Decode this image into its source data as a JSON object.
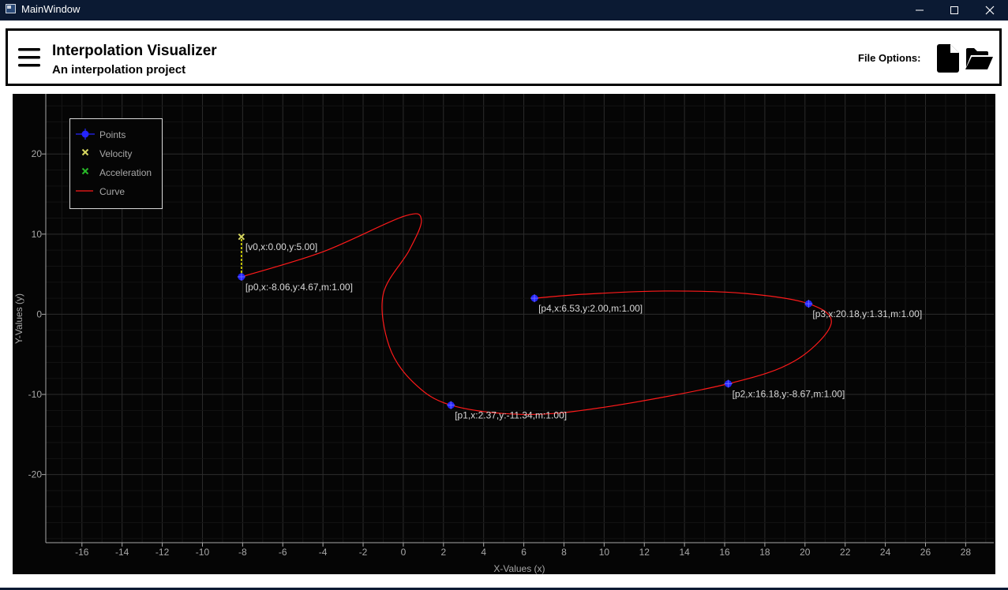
{
  "window": {
    "title": "MainWindow",
    "minimize_icon": "minimize-icon",
    "maximize_icon": "maximize-icon",
    "close_icon": "close-icon"
  },
  "header": {
    "menu_icon": "hamburger-icon",
    "title": "Interpolation Visualizer",
    "subtitle": "An interpolation project",
    "file_options_label": "File Options:",
    "new_file_icon": "new-file-icon",
    "open_folder_icon": "open-folder-icon"
  },
  "colors": {
    "titlebar": "#0b1a33",
    "plot_background": "#050505",
    "grid": "#2c2c2c",
    "axis_text": "#a8a8a8",
    "points": "#2424ff",
    "velocity": "#d6d660",
    "acceleration": "#28b828",
    "curve": "#ff1a1a",
    "velocity_line": "#f5f500"
  },
  "chart_data": {
    "type": "line",
    "xlabel": "X-Values (x)",
    "ylabel": "Y-Values (y)",
    "xlim": [
      -17.8,
      29.4
    ],
    "ylim": [
      -28.5,
      27.5
    ],
    "xticks": [
      -16,
      -14,
      -12,
      -10,
      -8,
      -6,
      -4,
      -2,
      0,
      2,
      4,
      6,
      8,
      10,
      12,
      14,
      16,
      18,
      20,
      22,
      24,
      26,
      28
    ],
    "yticks": [
      -20,
      -10,
      0,
      10,
      20
    ],
    "grid": true,
    "legend_position": "top-left",
    "legend": [
      "Points",
      "Velocity",
      "Acceleration",
      "Curve"
    ],
    "points": [
      {
        "label": "[p0,x:-8.06,y:4.67,m:1.00]",
        "x": -8.06,
        "y": 4.67
      },
      {
        "label": "[p1,x:2.37,y:-11.34,m:1.00]",
        "x": 2.37,
        "y": -11.34
      },
      {
        "label": "[p2,x:16.18,y:-8.67,m:1.00]",
        "x": 16.18,
        "y": -8.67
      },
      {
        "label": "[p3,x:20.18,y:1.31,m:1.00]",
        "x": 20.18,
        "y": 1.31
      },
      {
        "label": "[p4,x:6.53,y:2.00,m:1.00]",
        "x": 6.53,
        "y": 2.0
      }
    ],
    "velocity": [
      {
        "label": "[v0,x:0.00,y:5.00]",
        "x": 0.0,
        "y": 5.0,
        "origin": "p0"
      }
    ],
    "curve": [
      [
        -8.06,
        4.67
      ],
      [
        -4.0,
        7.8
      ],
      [
        0.0,
        12.2
      ],
      [
        0.9,
        11.8
      ],
      [
        0.3,
        8.0
      ],
      [
        -1.0,
        2.5
      ],
      [
        -0.7,
        -4.0
      ],
      [
        0.5,
        -8.5
      ],
      [
        2.37,
        -11.34
      ],
      [
        6.0,
        -12.5
      ],
      [
        10.0,
        -11.6
      ],
      [
        16.18,
        -8.67
      ],
      [
        19.5,
        -5.8
      ],
      [
        21.3,
        -1.2
      ],
      [
        20.18,
        1.31
      ],
      [
        17.0,
        2.6
      ],
      [
        13.0,
        2.9
      ],
      [
        9.0,
        2.5
      ],
      [
        6.53,
        2.0
      ]
    ]
  }
}
